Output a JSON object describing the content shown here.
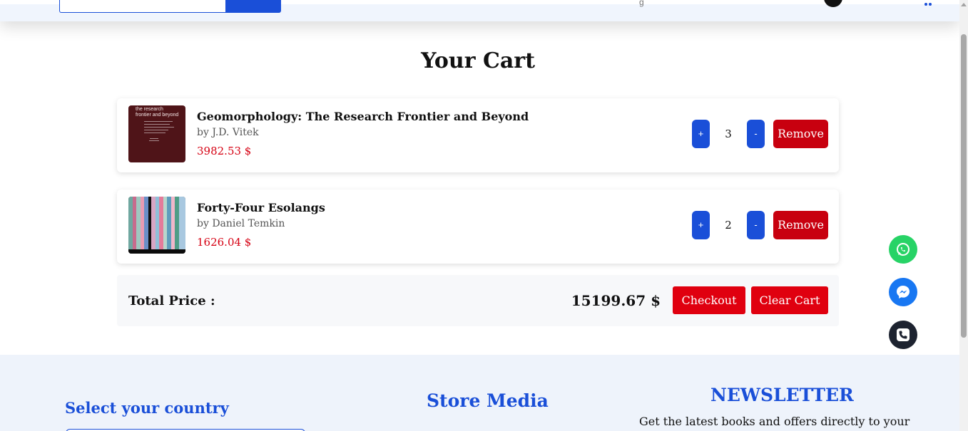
{
  "header": {
    "nav_fragment": "g",
    "icons": [
      "avatar",
      "cart-icon"
    ]
  },
  "page": {
    "title": "Your Cart"
  },
  "cart": {
    "items": [
      {
        "title": "Geomorphology: The Research Frontier and Beyond",
        "author": "by J.D. Vitek",
        "price": "3982.53 $",
        "quantity": "3",
        "plus_label": "+",
        "minus_label": "-",
        "remove_label": "Remove",
        "cover_text": "the research frontier and beyond"
      },
      {
        "title": "Forty-Four Esolangs",
        "author": "by Daniel Temkin",
        "price": "1626.04 $",
        "quantity": "2",
        "plus_label": "+",
        "minus_label": "-",
        "remove_label": "Remove"
      }
    ],
    "total_label": "Total Price :",
    "total_value": "15199.67 $",
    "checkout_label": "Checkout",
    "clear_label": "Clear Cart"
  },
  "floating": {
    "icons": [
      "whatsapp-icon",
      "messenger-icon",
      "phone-icon"
    ]
  },
  "footer": {
    "country_title": "Select your country",
    "media_title": "Store Media",
    "newsletter_title": "NEWSLETTER",
    "newsletter_text": "Get the latest books and offers directly to your"
  },
  "colors": {
    "accent": "#1a4fd8",
    "danger": "#e0000f",
    "price": "#d60012",
    "footer_bg": "#eef3fb"
  }
}
